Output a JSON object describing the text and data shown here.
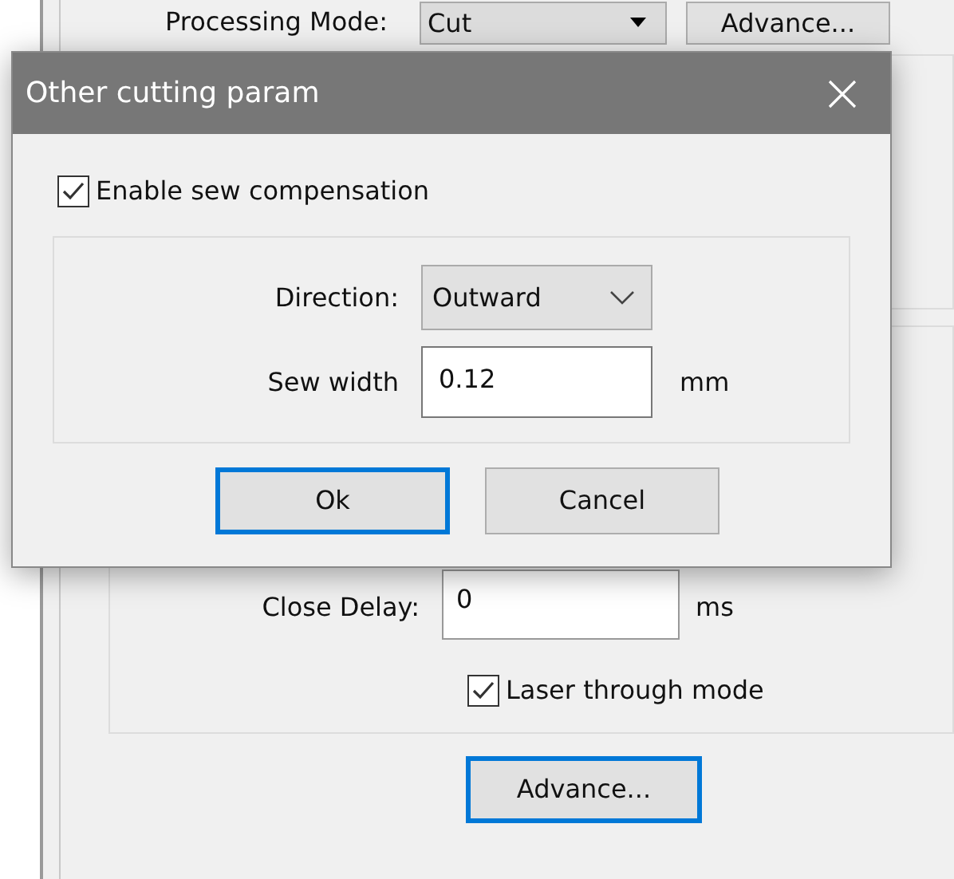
{
  "background": {
    "processing_mode": {
      "label": "Processing Mode:",
      "value": "Cut",
      "button": "Advance..."
    },
    "close_delay": {
      "label": "Close Delay:",
      "value": "0",
      "unit": "ms"
    },
    "laser_through_mode": {
      "label": "Laser through mode",
      "checked": true
    },
    "advance_button": {
      "label": "Advance...",
      "focused": true
    }
  },
  "dialog": {
    "title": "Other cutting param",
    "sew_compensation": {
      "label": "Enable sew compensation",
      "checked": true
    },
    "direction": {
      "label": "Direction:",
      "value": "Outward"
    },
    "sew_width": {
      "label": "Sew width",
      "value": "0.12",
      "unit": "mm"
    },
    "buttons": [
      {
        "label": "Ok",
        "focused": true
      },
      {
        "label": "Cancel",
        "focused": false
      }
    ]
  }
}
